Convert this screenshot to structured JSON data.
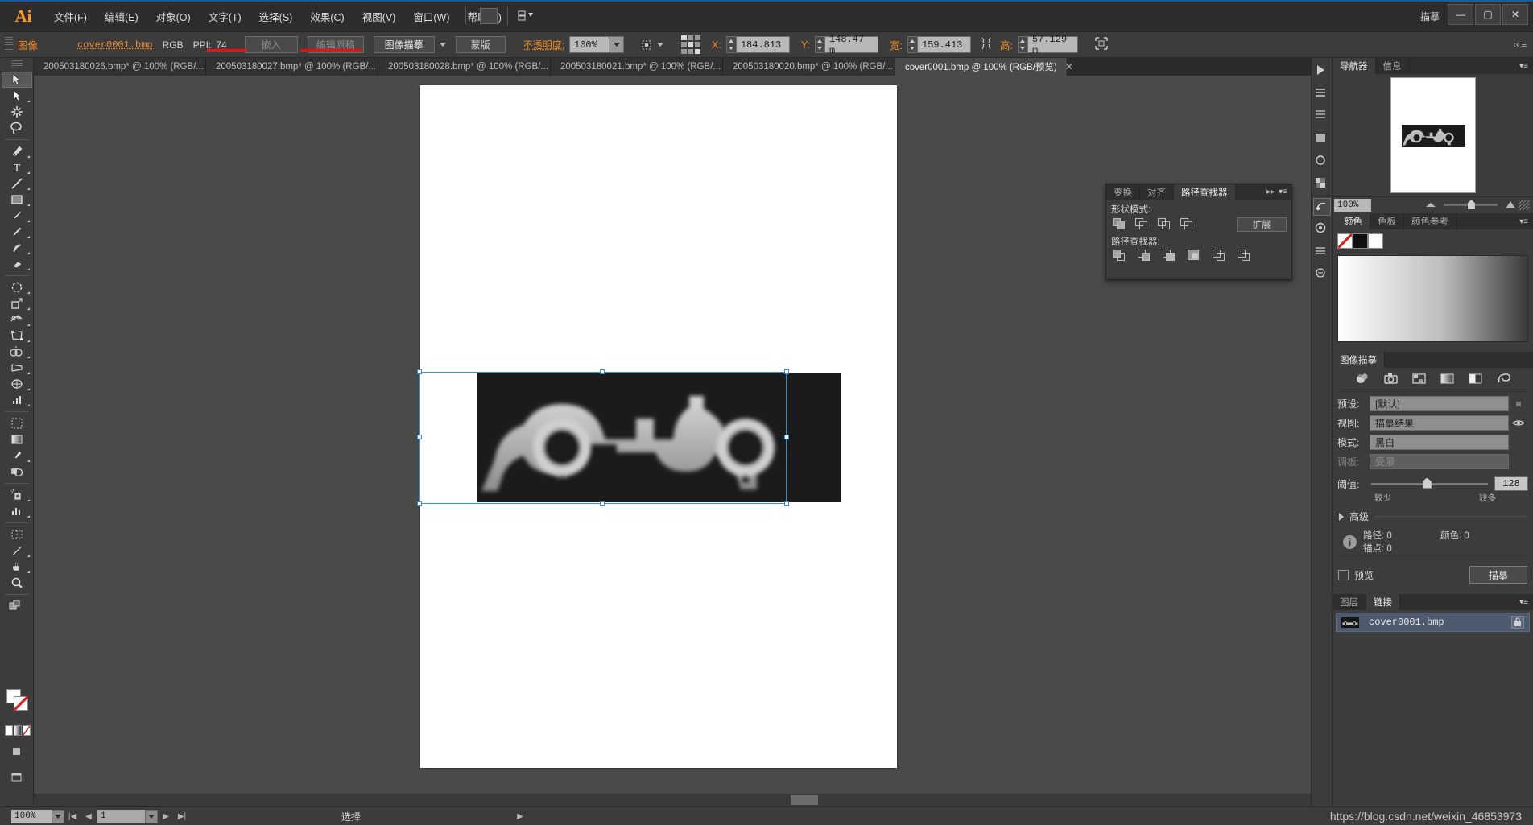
{
  "app": {
    "name": "Ai",
    "workspace": "描摹"
  },
  "window_controls": {
    "minimize": "—",
    "maximize": "▢",
    "close": "✕"
  },
  "menubar": [
    {
      "label": "文件(F)"
    },
    {
      "label": "编辑(E)"
    },
    {
      "label": "对象(O)"
    },
    {
      "label": "文字(T)"
    },
    {
      "label": "选择(S)"
    },
    {
      "label": "效果(C)"
    },
    {
      "label": "视图(V)"
    },
    {
      "label": "窗口(W)"
    },
    {
      "label": "帮助(H)"
    }
  ],
  "control_bar": {
    "object_type": "图像",
    "file_link": "cover0001.bmp",
    "color_mode": "RGB",
    "ppi_label": "PPI:",
    "ppi_value": "74",
    "embed_button": "嵌入",
    "edit_original_button": "编辑原稿",
    "image_trace_button": "图像描摹",
    "mask_button": "蒙版",
    "opacity_label": "不透明度:",
    "opacity_value": "100%",
    "x_label": "X:",
    "x_value": "184.813 ",
    "y_label": "Y:",
    "y_value": "148.47 m",
    "w_label": "宽:",
    "w_value": "159.413 ",
    "h_label": "高:",
    "h_value": "57.129 m"
  },
  "tabs": [
    {
      "label": "200503180026.bmp* @ 100% (RGB/...",
      "active": false
    },
    {
      "label": "200503180027.bmp* @ 100% (RGB/...",
      "active": false
    },
    {
      "label": "200503180028.bmp* @ 100% (RGB/...",
      "active": false
    },
    {
      "label": "200503180021.bmp* @ 100% (RGB/...",
      "active": false
    },
    {
      "label": "200503180020.bmp* @ 100% (RGB/...",
      "active": false
    },
    {
      "label": "cover0001.bmp @ 100% (RGB/预览)",
      "active": true
    }
  ],
  "toolbar": {
    "tools": [
      "selection-tool",
      "direct-selection-tool",
      "magic-wand-tool",
      "lasso-tool",
      "pen-tool",
      "type-tool",
      "line-segment-tool",
      "rectangle-tool",
      "paintbrush-tool",
      "pencil-tool",
      "blob-brush-tool",
      "eraser-tool",
      "rotate-tool",
      "scale-tool",
      "width-tool",
      "free-transform-tool",
      "shape-builder-tool",
      "perspective-grid-tool",
      "mesh-tool",
      "gradient-tool",
      "eyedropper-tool",
      "blend-tool",
      "symbol-sprayer-tool",
      "column-graph-tool",
      "artboard-tool",
      "slice-tool",
      "hand-tool",
      "zoom-tool"
    ]
  },
  "pathfinder_panel": {
    "tabs": [
      {
        "label": "变换",
        "active": false
      },
      {
        "label": "对齐",
        "active": false
      },
      {
        "label": "路径查找器",
        "active": true
      }
    ],
    "shape_modes_label": "形状模式:",
    "expand_button": "扩展",
    "pathfinders_label": "路径查找器:"
  },
  "navigator_panel": {
    "tabs": [
      {
        "label": "导航器",
        "active": true
      },
      {
        "label": "信息",
        "active": false
      }
    ],
    "zoom_value": "100%"
  },
  "color_panel": {
    "tabs": [
      {
        "label": "颜色",
        "active": true
      },
      {
        "label": "色板",
        "active": false
      },
      {
        "label": "颜色参考",
        "active": false
      }
    ]
  },
  "image_trace_panel": {
    "tabs": [
      {
        "label": "图像描摹",
        "active": true
      }
    ],
    "preset_icons": [
      "auto-color-icon",
      "high-color-icon",
      "low-color-icon",
      "grayscale-icon",
      "black-and-white-icon",
      "outline-icon"
    ],
    "preset_label": "预设:",
    "preset_value": "[默认]",
    "view_label": "视图:",
    "view_value": "描摹结果",
    "mode_label": "模式:",
    "mode_value": "黑白",
    "palette_label": "调板:",
    "palette_value": "受限",
    "threshold_label": "阈值:",
    "threshold_value": "128",
    "threshold_min_label": "较少",
    "threshold_max_label": "较多",
    "advanced_label": "高级",
    "paths_label": "路径:",
    "paths_value": "0",
    "colors_label": "颜色:",
    "colors_value": "0",
    "anchors_label": "锚点:",
    "anchors_value": "0",
    "preview_label": "预览",
    "trace_button": "描摹"
  },
  "layers_links_panel": {
    "tabs": [
      {
        "label": "图层",
        "active": false
      },
      {
        "label": "链接",
        "active": true
      }
    ],
    "items": [
      {
        "name": "cover0001.bmp"
      }
    ]
  },
  "status_bar": {
    "zoom_value": "100%",
    "page_value": "1",
    "status_text": "选择",
    "first_icon": "|◀",
    "prev_icon": "◀",
    "next_icon": "▶",
    "last_icon": "▶|"
  },
  "watermark": {
    "text": "https://blog.csdn.net/weixin_46853973"
  },
  "colors": {
    "accent_orange": "#f08a24",
    "panel_bg": "#3c3c3c",
    "canvas_bg": "#4a4a4a",
    "selection_blue": "#2f8ed6",
    "annotation_red": "#ee1111",
    "link_row_blue": "#4e5a6e"
  }
}
